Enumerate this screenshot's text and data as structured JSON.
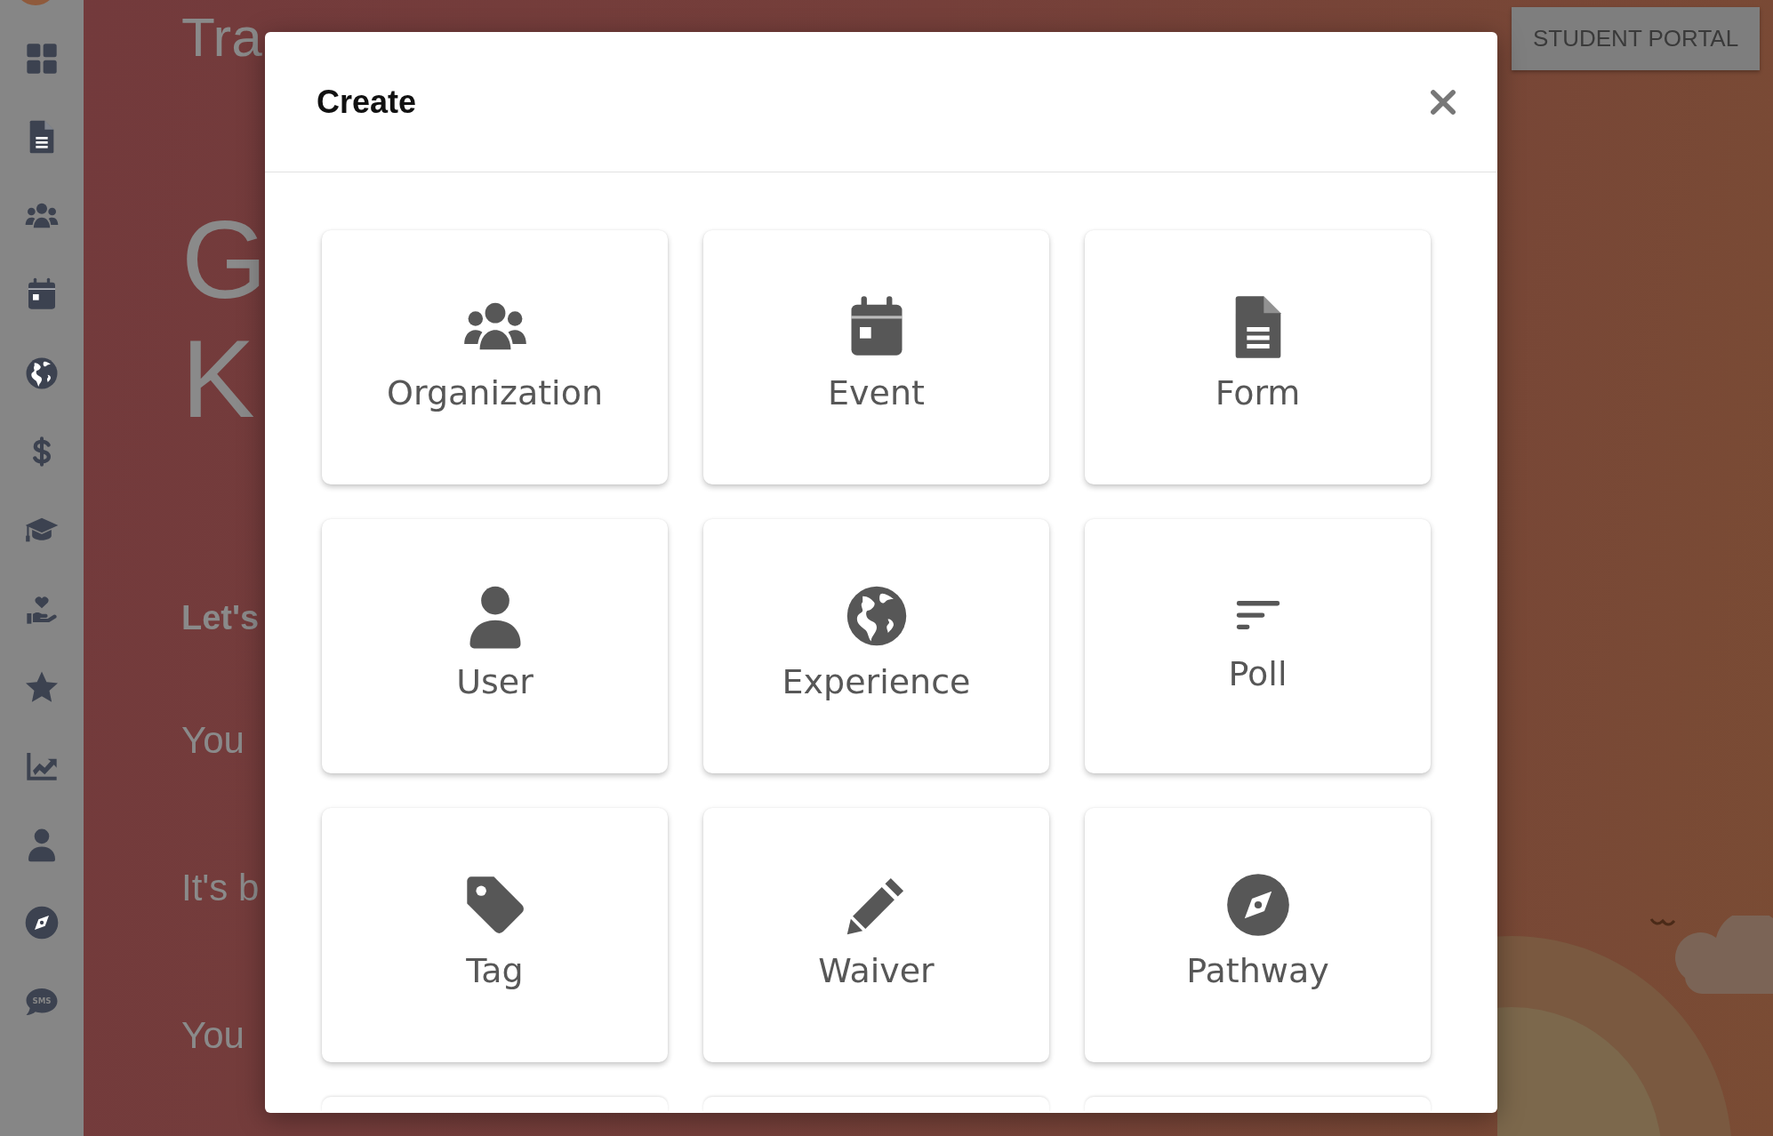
{
  "sidebar": {
    "sms_label": "SMS"
  },
  "background": {
    "title": "Tra",
    "heading_lines": [
      "G",
      "K"
    ],
    "subheading": "Let's",
    "paragraphs": [
      "You",
      "It's b",
      "You"
    ],
    "portal_button": "STUDENT PORTAL"
  },
  "dialog": {
    "title": "Create",
    "tiles": [
      {
        "label": "Organization"
      },
      {
        "label": "Event"
      },
      {
        "label": "Form"
      },
      {
        "label": "User"
      },
      {
        "label": "Experience"
      },
      {
        "label": "Poll"
      },
      {
        "label": "Tag"
      },
      {
        "label": "Waiver"
      },
      {
        "label": "Pathway"
      }
    ]
  }
}
